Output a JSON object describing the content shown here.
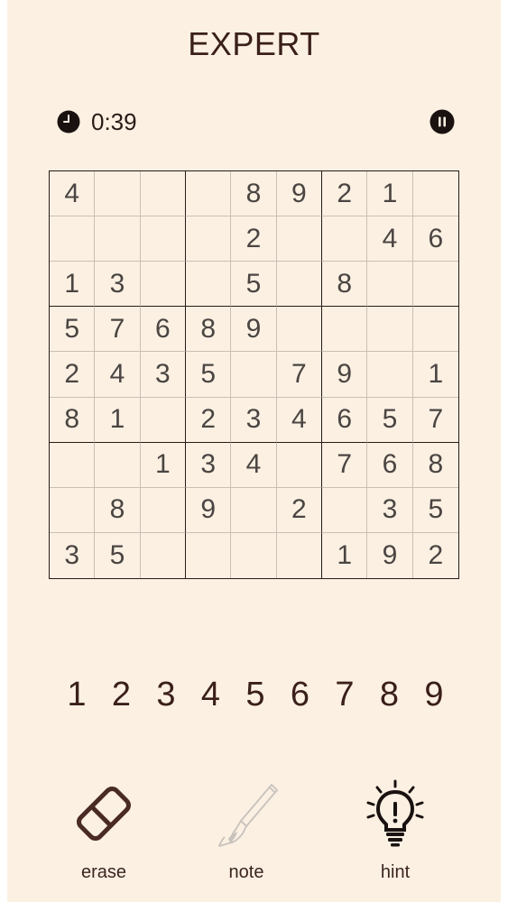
{
  "header": {
    "title": "EXPERT"
  },
  "status": {
    "timer": "0:39",
    "clock_icon": "clock-icon",
    "pause_icon": "pause-icon"
  },
  "board": {
    "rows": [
      [
        "4",
        "",
        "",
        "",
        "8",
        "9",
        "2",
        "1",
        ""
      ],
      [
        "",
        "",
        "",
        "",
        "2",
        "",
        "",
        "4",
        "6"
      ],
      [
        "1",
        "3",
        "",
        "",
        "5",
        "",
        "8",
        "",
        ""
      ],
      [
        "5",
        "7",
        "6",
        "8",
        "9",
        "",
        "",
        "",
        ""
      ],
      [
        "2",
        "4",
        "3",
        "5",
        "",
        "7",
        "9",
        "",
        "1"
      ],
      [
        "8",
        "1",
        "",
        "2",
        "3",
        "4",
        "6",
        "5",
        "7"
      ],
      [
        "",
        "",
        "1",
        "3",
        "4",
        "",
        "7",
        "6",
        "8"
      ],
      [
        "",
        "8",
        "",
        "9",
        "",
        "2",
        "",
        "3",
        "5"
      ],
      [
        "3",
        "5",
        "",
        "",
        "",
        "",
        "1",
        "9",
        "2"
      ]
    ]
  },
  "numpad": {
    "keys": [
      "1",
      "2",
      "3",
      "4",
      "5",
      "6",
      "7",
      "8",
      "9"
    ]
  },
  "tools": {
    "erase": {
      "label": "erase",
      "icon": "eraser-icon"
    },
    "note": {
      "label": "note",
      "icon": "pencil-icon"
    },
    "hint": {
      "label": "hint",
      "icon": "lightbulb-icon"
    }
  },
  "colors": {
    "background": "#fbf0e2",
    "text": "#3a1f1a",
    "disabled": "#c8c2bc"
  }
}
